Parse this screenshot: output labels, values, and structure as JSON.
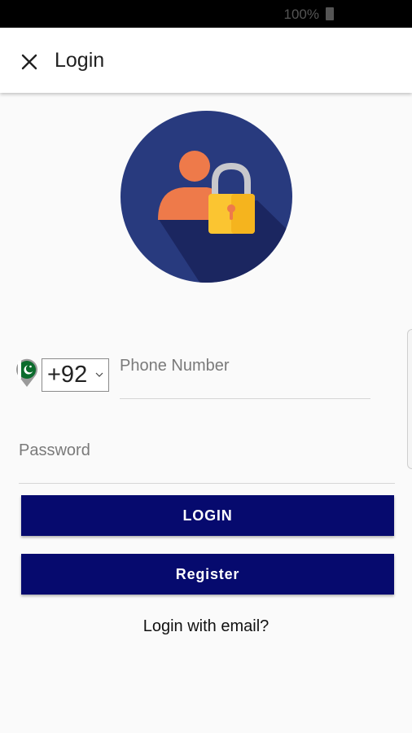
{
  "status": {
    "battery": "100%"
  },
  "app_bar": {
    "title": "Login"
  },
  "form": {
    "country_code": "+92",
    "phone_placeholder": "Phone Number",
    "password_placeholder": "Password"
  },
  "buttons": {
    "login": "LOGIN",
    "register": "Register"
  },
  "link": {
    "email": "Login with email?"
  },
  "colors": {
    "primary": "#060a6e",
    "illustration_bg": "#283a7e",
    "person": "#ee7a4a",
    "lock": "#fbc531"
  },
  "icons": {
    "close": "close-icon",
    "flag": "pakistan-flag-icon",
    "chevron": "chevron-down-icon",
    "illustration": "user-lock-illustration"
  }
}
